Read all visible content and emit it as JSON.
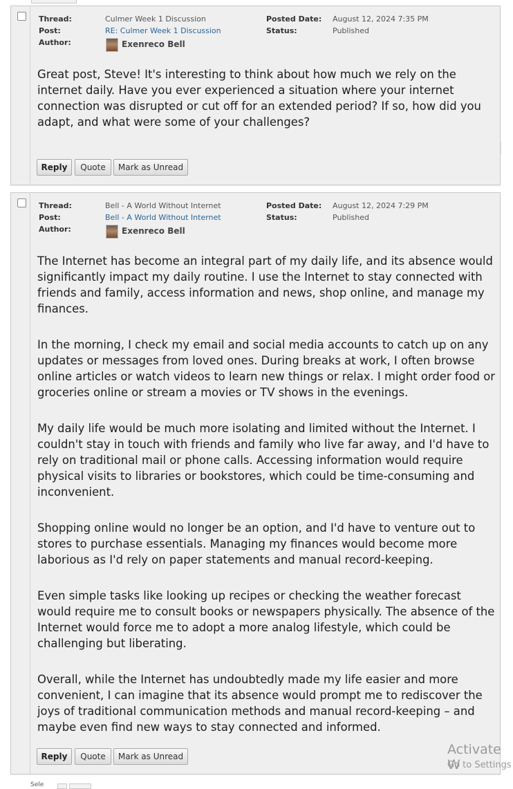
{
  "posts": [
    {
      "thread_label": "Thread:",
      "thread": "Culmer Week 1 Discussion",
      "post_label": "Post:",
      "post": "RE: Culmer Week 1 Discussion",
      "author_label": "Author:",
      "author": "Exenreco Bell",
      "posted_label": "Posted Date:",
      "posted": "August 12, 2024 7:35 PM",
      "status_label": "Status:",
      "status": "Published",
      "paragraphs": [
        "Great post, Steve! It's interesting to think about how much we rely on the internet daily. Have you ever experienced a situation where your internet connection was disrupted or cut off for an extended period? If so, how did you adapt, and what were some of your challenges?"
      ],
      "buttons": {
        "reply": "Reply",
        "quote": "Quote",
        "mark_unread": "Mark as Unread"
      }
    },
    {
      "thread_label": "Thread:",
      "thread": "Bell - A World Without Internet",
      "post_label": "Post:",
      "post": "Bell - A World Without Internet",
      "author_label": "Author:",
      "author": "Exenreco Bell",
      "posted_label": "Posted Date:",
      "posted": "August 12, 2024 7:29 PM",
      "status_label": "Status:",
      "status": "Published",
      "paragraphs": [
        "The Internet has become an integral part of my daily life, and its absence would significantly impact my daily routine. I use the Internet to stay connected with friends and family, access information and news, shop online, and manage my finances.",
        "In the morning, I check my email and social media accounts to catch up on any updates or messages from loved ones. During breaks at work, I often browse online articles or watch videos to learn new things or relax. I might order food or groceries online or stream a movies or TV shows in the evenings.",
        "My daily life would be much more isolating and limited without the Internet. I couldn't stay in touch with friends and family who live far away, and I'd have to rely on traditional mail or phone calls. Accessing information would require physical visits to libraries or bookstores, which could be time-consuming and inconvenient.",
        "Shopping online would no longer be an option, and I'd have to venture out to stores to purchase essentials. Managing my finances would become more laborious as I'd rely on paper statements and manual record-keeping.",
        "Even simple tasks like looking up recipes or checking the weather forecast would require me to consult books or newspapers physically. The absence of the Internet would force me to adopt a more analog lifestyle, which could be challenging but liberating.",
        "Overall, while the Internet has undoubtedly made my life easier and more convenient, I can imagine that its absence would prompt me to rediscover the joys of traditional communication methods and manual record-keeping – and maybe even find new ways to stay connected and informed."
      ],
      "buttons": {
        "reply": "Reply",
        "quote": "Quote",
        "mark_unread": "Mark as Unread"
      }
    }
  ],
  "watermark": {
    "line1": "Activate W",
    "line2": "Go to Settings"
  },
  "bottom": {
    "label": "Sele"
  }
}
